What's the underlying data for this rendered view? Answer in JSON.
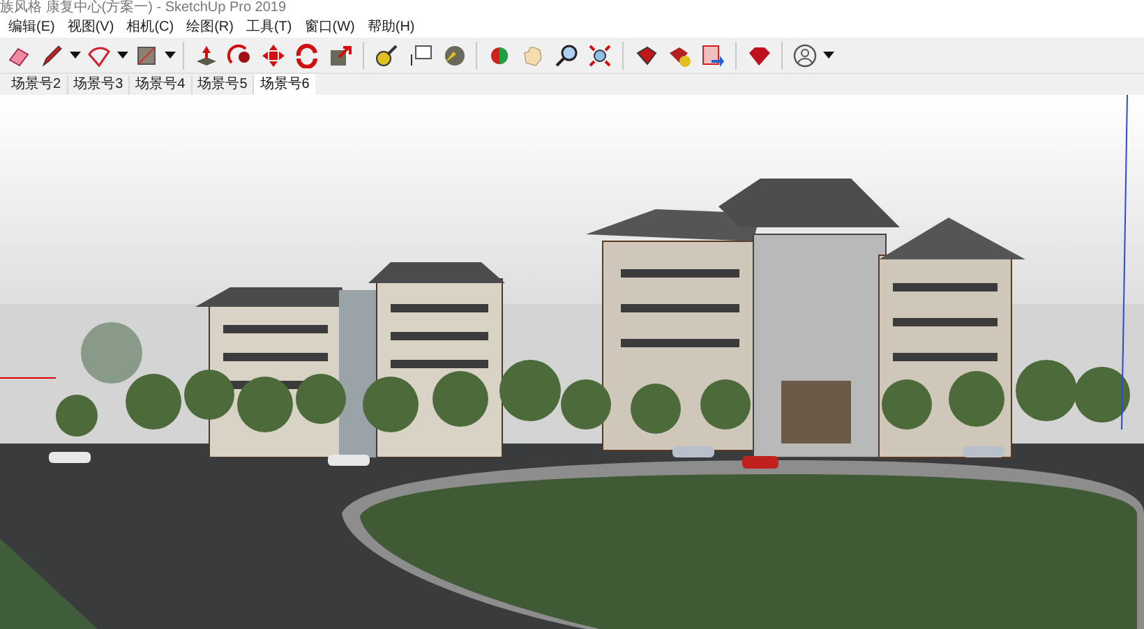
{
  "window": {
    "title": "族风格 康复中心(方案一)  - SketchUp Pro 2019"
  },
  "menu": [
    "编辑(E)",
    "视图(V)",
    "相机(C)",
    "绘图(R)",
    "工具(T)",
    "窗口(W)",
    "帮助(H)"
  ],
  "scene_tabs": [
    {
      "label": "场景号2",
      "selected": false
    },
    {
      "label": "场景号3",
      "selected": false
    },
    {
      "label": "场景号4",
      "selected": false
    },
    {
      "label": "场景号5",
      "selected": false
    },
    {
      "label": "场景号6",
      "selected": true
    }
  ]
}
